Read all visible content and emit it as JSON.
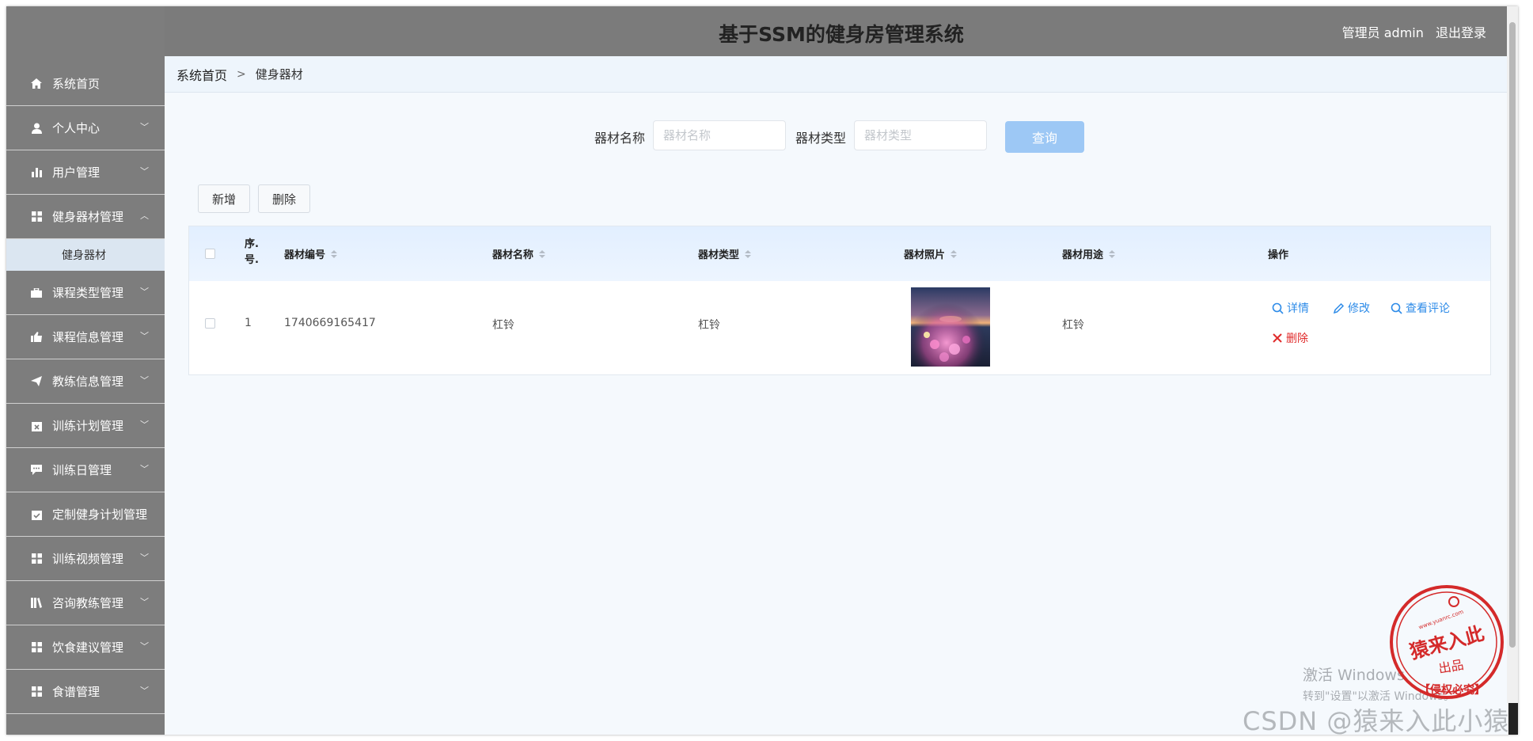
{
  "header": {
    "title": "基于SSM的健身房管理系统",
    "role": "管理员 admin",
    "logout": "退出登录"
  },
  "breadcrumb": {
    "home": "系统首页",
    "sep": ">",
    "current": "健身器材"
  },
  "sidebar": {
    "items": [
      {
        "label": "系统首页",
        "icon": "home-icon"
      },
      {
        "label": "个人中心",
        "icon": "user-icon"
      },
      {
        "label": "用户管理",
        "icon": "bar-chart-icon"
      },
      {
        "label": "健身器材管理",
        "icon": "grid-icon"
      },
      {
        "label": "课程类型管理",
        "icon": "briefcase-icon"
      },
      {
        "label": "课程信息管理",
        "icon": "thumbs-up-icon"
      },
      {
        "label": "教练信息管理",
        "icon": "send-icon"
      },
      {
        "label": "训练计划管理",
        "icon": "calendar-x-icon"
      },
      {
        "label": "训练日管理",
        "icon": "comment-icon"
      },
      {
        "label": "定制健身计划管理",
        "icon": "calendar-check-icon"
      },
      {
        "label": "训练视频管理",
        "icon": "grid-icon"
      },
      {
        "label": "咨询教练管理",
        "icon": "books-icon"
      },
      {
        "label": "饮食建议管理",
        "icon": "grid-icon"
      },
      {
        "label": "食谱管理",
        "icon": "grid-icon"
      }
    ],
    "sub_item": "健身器材"
  },
  "search": {
    "name_label": "器材名称",
    "name_placeholder": "器材名称",
    "type_label": "器材类型",
    "type_placeholder": "器材类型",
    "query_button": "查询"
  },
  "actions": {
    "add": "新增",
    "delete": "删除"
  },
  "table": {
    "columns": [
      "序号",
      "器材编号",
      "器材名称",
      "器材类型",
      "器材照片",
      "器材用途",
      "操作"
    ],
    "seq_header": [
      "序.",
      "号."
    ],
    "rows": [
      {
        "index": "1",
        "code": "1740669165417",
        "name": "杠铃",
        "type": "杠铃",
        "usage": "杠铃"
      }
    ],
    "ops": {
      "detail": "详情",
      "edit": "修改",
      "comments": "查看评论",
      "delete": "删除"
    }
  },
  "watermark": {
    "windows_line1": "激活 Windows",
    "windows_line2": "转到\"设置\"以激活 Windows。",
    "csdn": "CSDN @猿来入此小猿",
    "seal_text": "猿来入此",
    "seal_sub": "出品",
    "seal_bottom": "【侵权必究】",
    "seal_url": "www.yuanrc.com"
  },
  "colors": {
    "sidebar": "#7d7d7d",
    "header": "#7b7b7b",
    "link": "#2d8be8",
    "danger": "#e02b2b",
    "seal": "#d42a2a"
  }
}
